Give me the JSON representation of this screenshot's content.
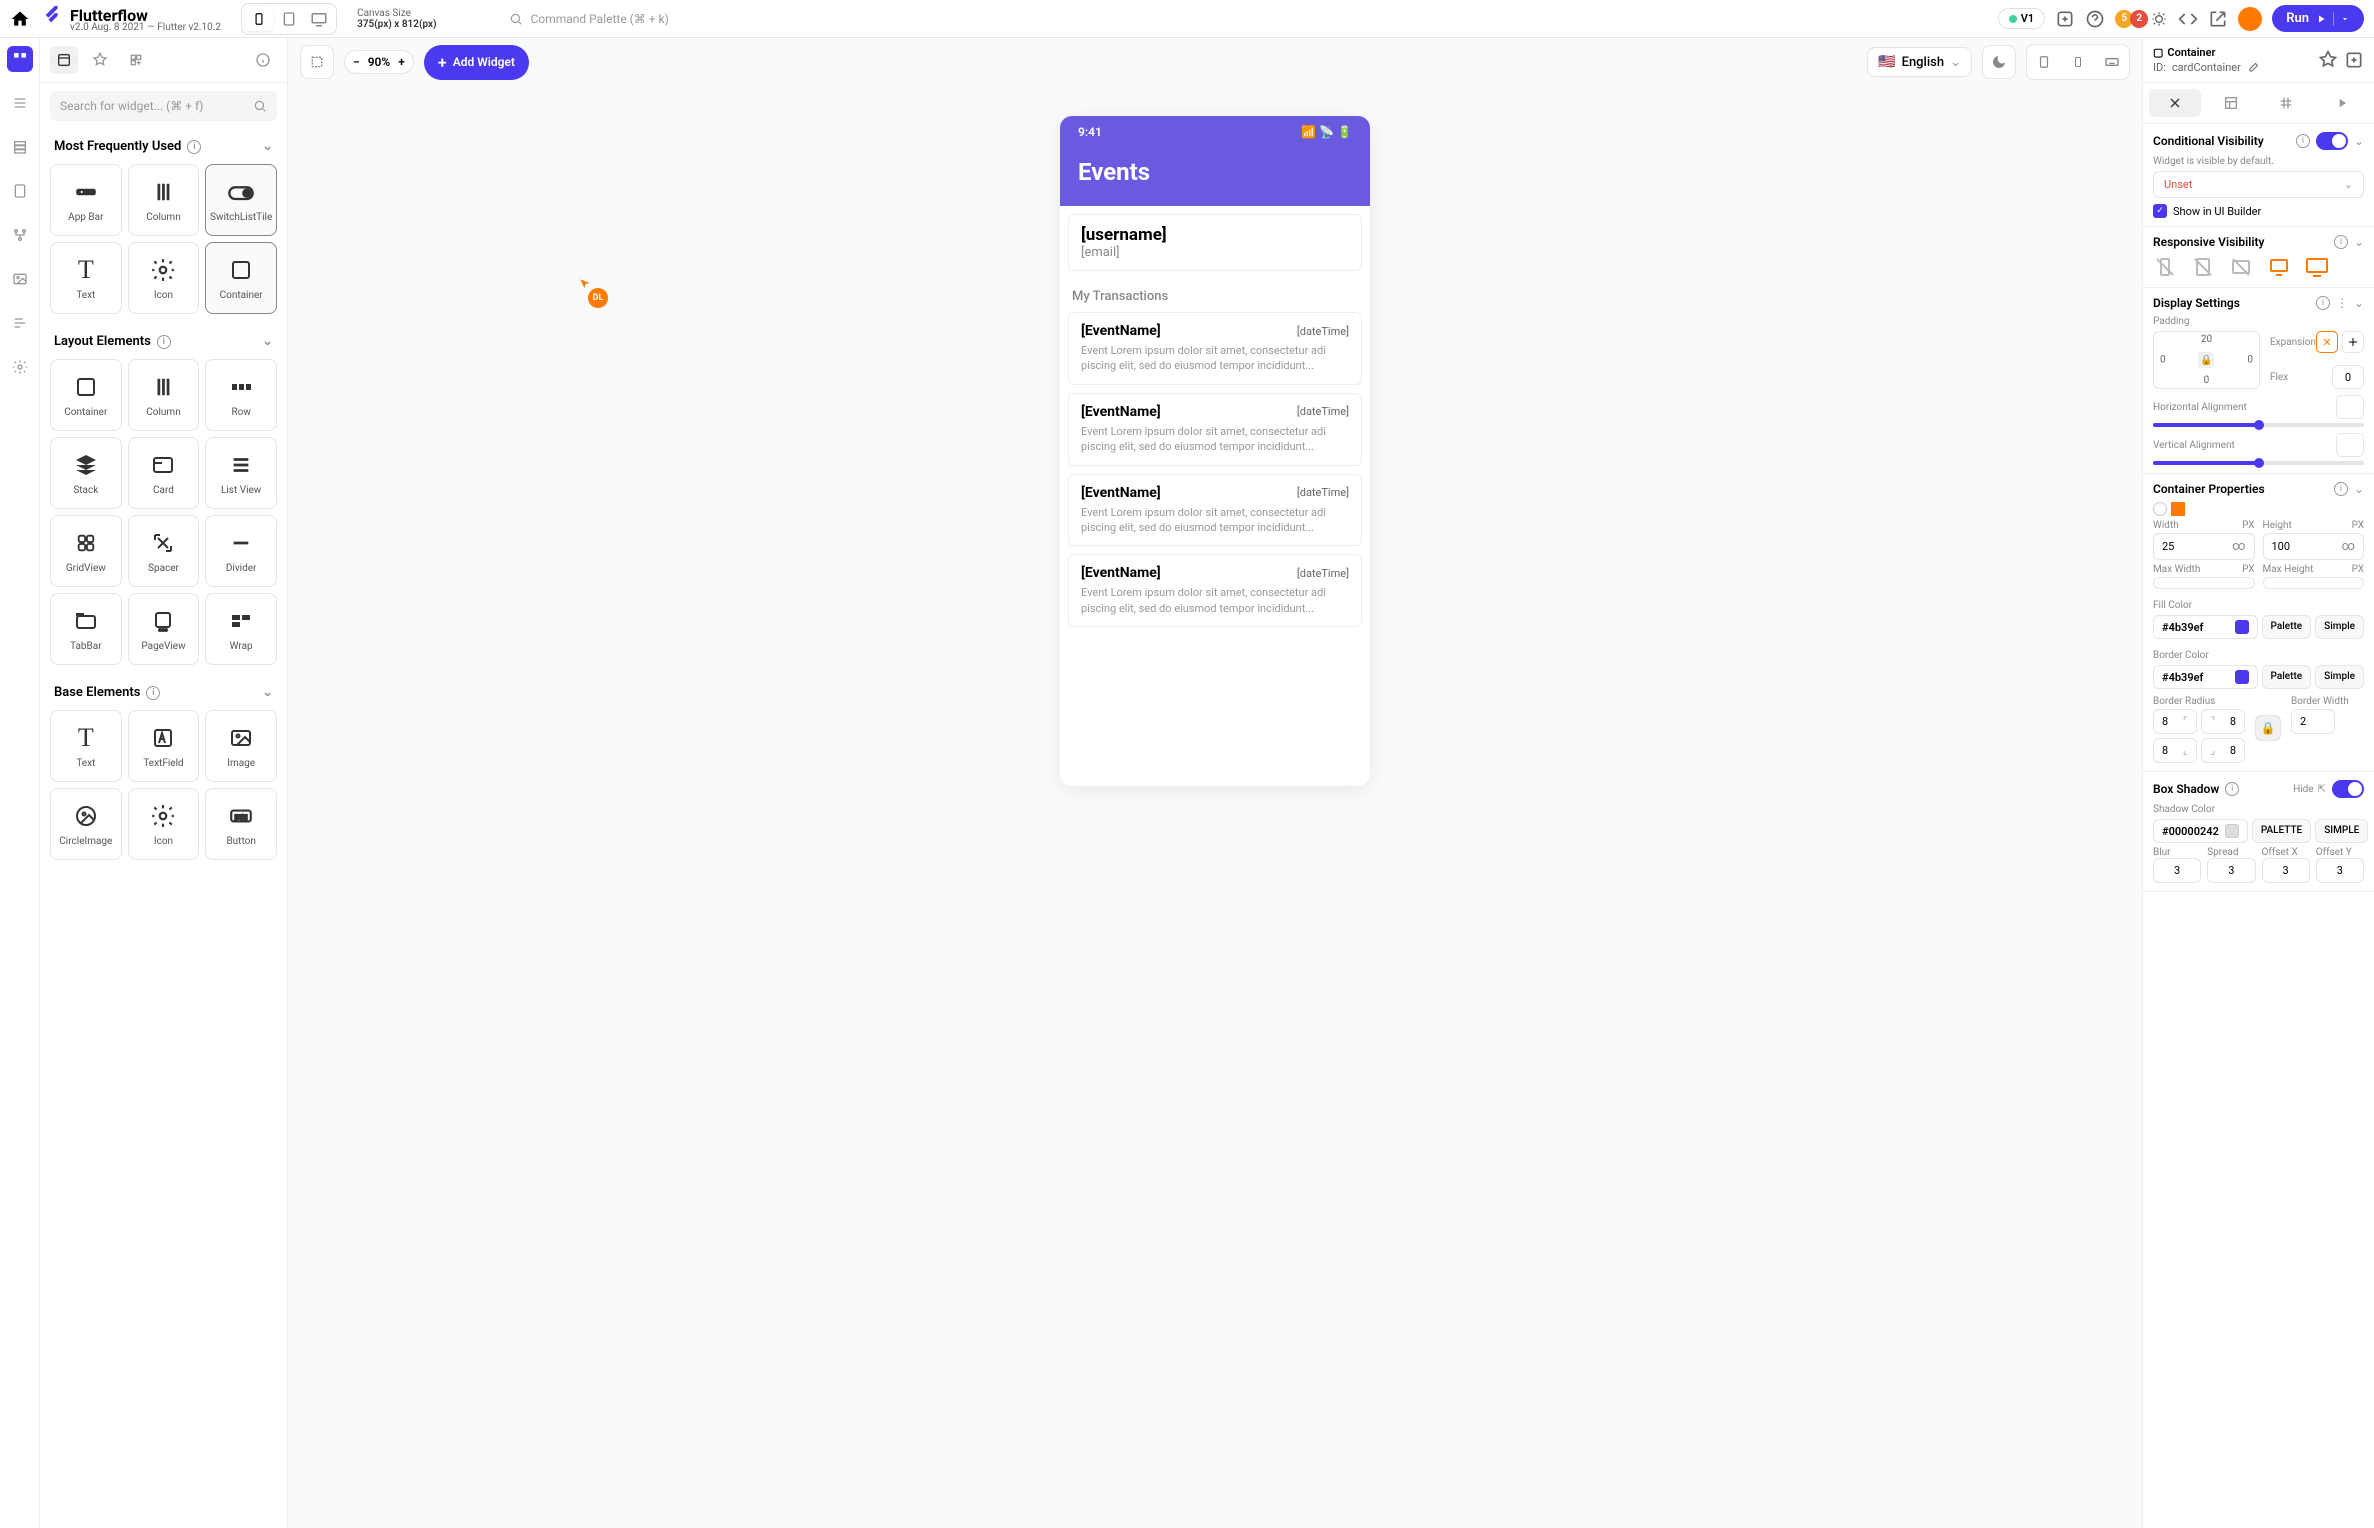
{
  "topbar": {
    "brand": "Flutterflow",
    "version": "v2.0 Aug. 8 2021 — Flutter v2.10.2",
    "canvas_label": "Canvas Size",
    "canvas_dims": "375(px) x 812(px)",
    "cmd_placeholder": "Command Palette (⌘ + k)",
    "v_badge": "V1",
    "err1": "5",
    "err2": "2",
    "run_label": "Run"
  },
  "widgetPanel": {
    "search_placeholder": "Search for widget... (⌘ + f)",
    "sections": {
      "mfu": "Most Frequently Used",
      "layout": "Layout Elements",
      "base": "Base Elements"
    },
    "mfu": [
      "App Bar",
      "Column",
      "SwitchListTile",
      "Text",
      "Icon",
      "Container"
    ],
    "layout": [
      "Container",
      "Column",
      "Row",
      "Stack",
      "Card",
      "List View",
      "GridView",
      "Spacer",
      "Divider",
      "TabBar",
      "PageView",
      "Wrap"
    ],
    "base": [
      "Text",
      "TextField",
      "Image",
      "CircleImage",
      "Icon",
      "Button"
    ]
  },
  "canvas": {
    "zoom": "90%",
    "add_widget": "Add Widget",
    "lang": "English",
    "cursor_user": "DL"
  },
  "phone": {
    "time": "9:41",
    "title": "Events",
    "username": "[username]",
    "email": "[email]",
    "section": "My Transactions",
    "events": [
      {
        "name": "[EventName]",
        "date": "[dateTime]",
        "desc": "Event Lorem ipsum dolor sit amet, consectetur adi piscing elit, sed do eiusmod tempor incididunt..."
      },
      {
        "name": "[EventName]",
        "date": "[dateTime]",
        "desc": "Event Lorem ipsum dolor sit amet, consectetur adi piscing elit, sed do eiusmod tempor incididunt..."
      },
      {
        "name": "[EventName]",
        "date": "[dateTime]",
        "desc": "Event Lorem ipsum dolor sit amet, consectetur adi piscing elit, sed do eiusmod tempor incididunt..."
      },
      {
        "name": "[EventName]",
        "date": "[dateTime]",
        "desc": "Event Lorem ipsum dolor sit amet, consectetur adi piscing elit, sed do eiusmod tempor incididunt..."
      }
    ]
  },
  "props": {
    "type": "Container",
    "id_label": "ID:",
    "id": "cardContainer",
    "cv_label": "Conditional Visibility",
    "cv_desc": "Widget is visible by default.",
    "cv_select": "Unset",
    "show_builder": "Show in UI Builder",
    "rv_label": "Responsive Visibility",
    "ds_label": "Display Settings",
    "padding_label": "Padding",
    "padding": {
      "t": "20",
      "r": "0",
      "b": "0",
      "l": "0"
    },
    "exp_label": "Expansion",
    "flex_label": "Flex",
    "flex": "0",
    "halign": "Horizontal Alignment",
    "valign": "Vertical Alignment",
    "cp_label": "Container Properties",
    "width_label": "Width",
    "width": "25",
    "height_label": "Height",
    "height": "100",
    "unit": "PX",
    "maxw_label": "Max Width",
    "maxh_label": "Max Height",
    "fill_label": "Fill Color",
    "fill": "#4b39ef",
    "border_label": "Border Color",
    "border": "#4b39ef",
    "palette": "Palette",
    "simple": "Simple",
    "palette_up": "PALETTE",
    "simple_up": "SIMPLE",
    "radius_label": "Border Radius",
    "bwidth_label": "Border Width",
    "bwidth": "2",
    "radius": "8",
    "shadow_label": "Box Shadow",
    "shadow_hide": "Hide",
    "shadow_color_label": "Shadow Color",
    "shadow_color": "#00000242",
    "blur_label": "Blur",
    "spread_label": "Spread",
    "ox_label": "Offset X",
    "oy_label": "Offset Y",
    "blur": "3",
    "spread": "3",
    "ox": "3",
    "oy": "3"
  }
}
